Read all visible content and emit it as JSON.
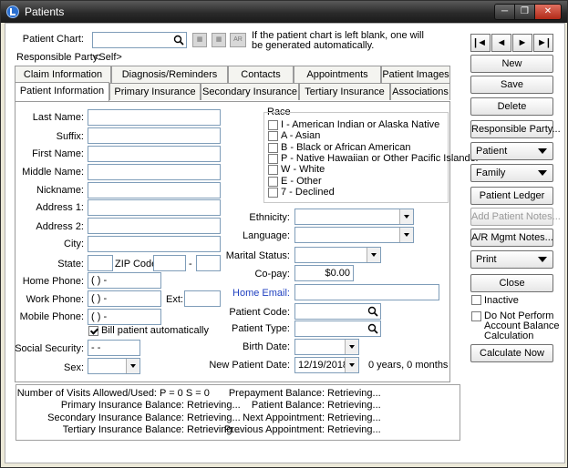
{
  "window": {
    "title": "Patients",
    "controls": [
      "minimize",
      "restore",
      "close"
    ]
  },
  "header": {
    "patient_chart_label": "Patient Chart:",
    "patient_chart_value": "",
    "ar_label": "AR",
    "hint_line1": "If the patient chart is left blank, one will",
    "hint_line2": "be generated automatically.",
    "responsible_party_label": "Responsible Party:",
    "responsible_party_value": "<Self>"
  },
  "tabs_top": [
    "Claim Information",
    "Diagnosis/Reminders",
    "Contacts",
    "Appointments",
    "Patient Images"
  ],
  "tabs_bottom": [
    "Patient Information",
    "Primary Insurance",
    "Secondary Insurance",
    "Tertiary Insurance",
    "Associations"
  ],
  "form": {
    "last_name": "Last Name:",
    "suffix": "Suffix:",
    "first_name": "First Name:",
    "middle_name": "Middle Name:",
    "nickname": "Nickname:",
    "address1": "Address 1:",
    "address2": "Address 2:",
    "city": "City:",
    "state": "State:",
    "zip": "ZIP Code:",
    "zip_sep": "-",
    "home_phone": "Home Phone:",
    "work_phone": "Work Phone:",
    "ext": "Ext:",
    "mobile_phone": "Mobile Phone:",
    "phone_mask": "(   )     -",
    "bill_auto": "Bill patient automatically",
    "ssn": "Social Security:",
    "ssn_mask": "  -   -",
    "sex": "Sex:",
    "race_label": "Race",
    "race_options": [
      "I -  American Indian or Alaska Native",
      "A -  Asian",
      "B -  Black or African American",
      "P -  Native Hawaiian or Other Pacific Islander",
      "W - White",
      "E -  Other",
      "7 -  Declined"
    ],
    "ethnicity": "Ethnicity:",
    "language": "Language:",
    "marital": "Marital Status:",
    "copay": "Co-pay:",
    "copay_value": "$0.00",
    "home_email": "Home Email:",
    "patient_code": "Patient Code:",
    "patient_type": "Patient Type:",
    "birth_date": "Birth Date:",
    "new_patient_date": "New Patient Date:",
    "new_patient_date_value": "12/19/2018",
    "age_text": "0 years, 0 months"
  },
  "summary": {
    "visits": "Number of Visits Allowed/Used:",
    "visits_value": "P = 0  S = 0",
    "primary": "Primary Insurance Balance:",
    "secondary": "Secondary Insurance Balance:",
    "tertiary": "Tertiary Insurance Balance:",
    "prepayment": "Prepayment Balance:",
    "patient_balance": "Patient Balance:",
    "next_appt": "Next Appointment:",
    "prev_appt": "Previous Appointment:",
    "retrieving": "Retrieving..."
  },
  "right": {
    "nav": [
      "|◄",
      "◄",
      "►",
      "►|"
    ],
    "new": "New",
    "save": "Save",
    "delete": "Delete",
    "responsible_party": "Responsible Party...",
    "patient": "Patient",
    "family": "Family",
    "ledger": "Patient Ledger",
    "add_notes": "Add Patient Notes...",
    "ar_notes": "A/R Mgmt Notes...",
    "print": "Print",
    "close": "Close",
    "inactive": "Inactive",
    "no_balance_line1": "Do Not Perform",
    "no_balance_line2": "Account Balance",
    "no_balance_line3": "Calculation",
    "calculate": "Calculate Now"
  }
}
